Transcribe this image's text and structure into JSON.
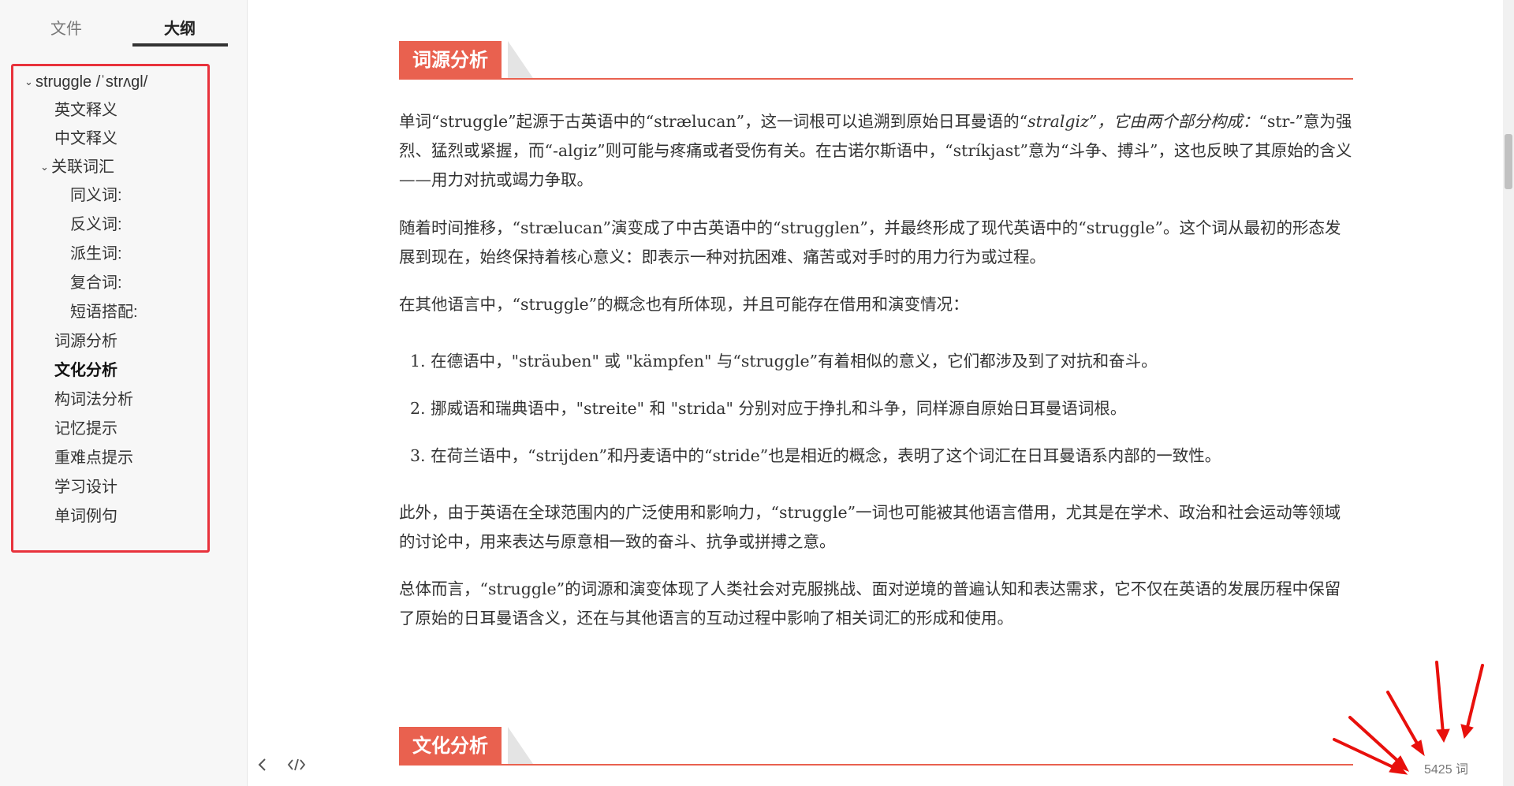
{
  "sidebar": {
    "tabs": {
      "files": "文件",
      "outline": "大纲"
    },
    "outline": [
      {
        "label": "struggle /ˈstrʌgl/",
        "level": 0,
        "collapsible": true
      },
      {
        "label": "英文释义",
        "level": 1
      },
      {
        "label": "中文释义",
        "level": 1
      },
      {
        "label": "关联词汇",
        "level": 1,
        "collapsible": true
      },
      {
        "label": "同义词:",
        "level": 2
      },
      {
        "label": "反义词:",
        "level": 2
      },
      {
        "label": "派生词:",
        "level": 2
      },
      {
        "label": "复合词:",
        "level": 2
      },
      {
        "label": "短语搭配:",
        "level": 2
      },
      {
        "label": "词源分析",
        "level": 1
      },
      {
        "label": "文化分析",
        "level": 1,
        "active": true
      },
      {
        "label": "构词法分析",
        "level": 1
      },
      {
        "label": "记忆提示",
        "level": 1
      },
      {
        "label": "重难点提示",
        "level": 1
      },
      {
        "label": "学习设计",
        "level": 1
      },
      {
        "label": "单词例句",
        "level": 1
      }
    ],
    "footer": {
      "back_icon": "chevron-left-icon",
      "source_icon": "code-icon"
    }
  },
  "content": {
    "section1_title": "词源分析",
    "p1_a": "单词“struggle”起源于古英语中的“strælucan”，这一词根可以追溯到原始日耳曼语的“",
    "p1_em": "stralgiz”，它由两个部分构成：",
    "p1_b": "“str-”意为强烈、猛烈或紧握，而“-algiz”则可能与疼痛或者受伤有关。在古诺尔斯语中，“stríkjast”意为“斗争、搏斗”，这也反映了其原始的含义——用力对抗或竭力争取。",
    "p2": "随着时间推移，“strælucan”演变成了中古英语中的“strugglen”，并最终形成了现代英语中的“struggle”。这个词从最初的形态发展到现在，始终保持着核心意义：即表示一种对抗困难、痛苦或对手时的用力行为或过程。",
    "p3": "在其他语言中，“struggle”的概念也有所体现，并且可能存在借用和演变情况：",
    "list": [
      "1. 在德语中，\"sträuben\" 或 \"kämpfen\" 与“struggle”有着相似的意义，它们都涉及到了对抗和奋斗。",
      "2. 挪威语和瑞典语中，\"streite\" 和 \"strida\" 分别对应于挣扎和斗争，同样源自原始日耳曼语词根。",
      "3. 在荷兰语中，“strijden”和丹麦语中的“stride”也是相近的概念，表明了这个词汇在日耳曼语系内部的一致性。"
    ],
    "p4": "此外，由于英语在全球范围内的广泛使用和影响力，“struggle”一词也可能被其他语言借用，尤其是在学术、政治和社会运动等领域的讨论中，用来表达与原意相一致的奋斗、抗争或拼搏之意。",
    "p5": "总体而言，“struggle”的词源和演变体现了人类社会对克服挑战、面对逆境的普遍认知和表达需求，它不仅在英语的发展历程中保留了原始的日耳曼语含义，还在与其他语言的互动过程中影响了相关词汇的形成和使用。",
    "section2_title": "文化分析"
  },
  "status": {
    "word_count": "5425 词"
  },
  "colors": {
    "accent": "#e9614f",
    "highlight_box": "#e8323c"
  }
}
